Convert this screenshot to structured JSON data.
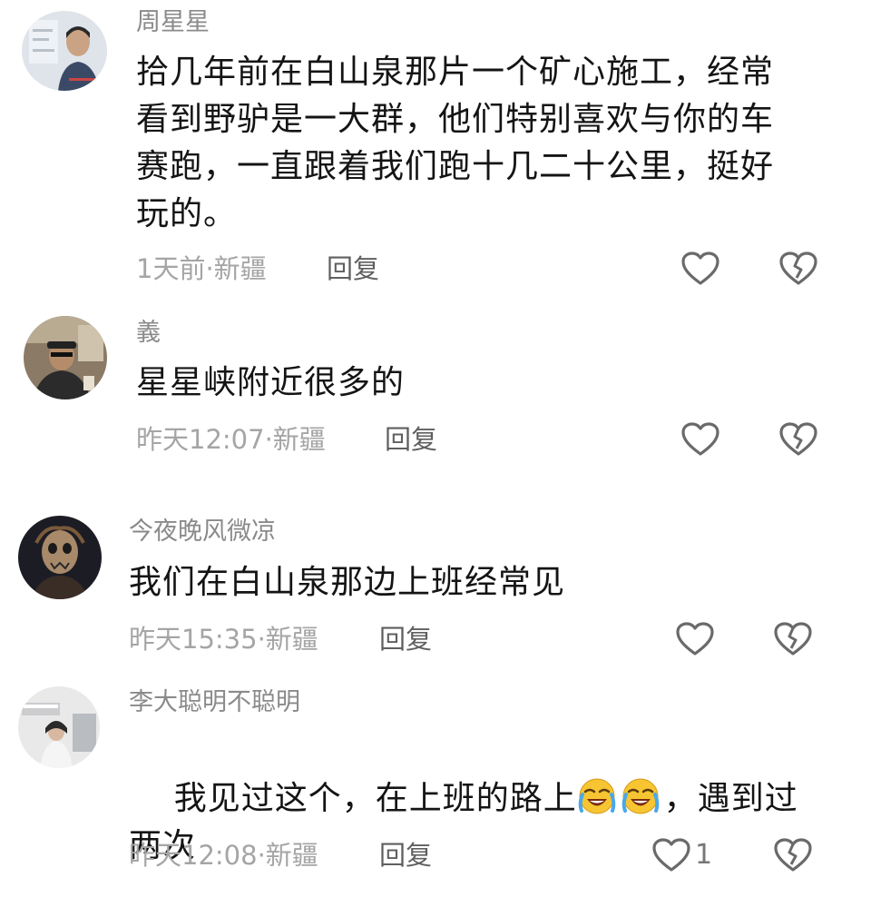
{
  "comments": [
    {
      "username": "周星星",
      "text": "拾几年前在白山泉那片一个矿心施工，经常\n看到野驴是一大群，他们特别喜欢与你的车\n赛跑，一直跟着我们跑十几二十公里，挺好\n玩的。",
      "meta": "1天前·新疆",
      "reply": "回复"
    },
    {
      "username": "義",
      "text": "星星峡附近很多的",
      "meta": "昨天12:07·新疆",
      "reply": "回复"
    },
    {
      "username": "今夜晚风微凉",
      "text": "我们在白山泉那边上班经常见",
      "meta": "昨天15:35·新疆",
      "reply": "回复"
    },
    {
      "username": "李大聪明不聪明",
      "text_before": "我见过这个，在上班的路上",
      "emoji": "loudly-crying-face-icon",
      "text_after": "，遇到过\n两次",
      "meta": "昨天12:08·新疆",
      "reply": "回复",
      "likes": "1"
    }
  ],
  "colors": {
    "username": "#8a8a8a",
    "text": "#141414",
    "meta": "#a5a5a5",
    "reply": "#5f5f5f",
    "icon": "#6a6a6a"
  },
  "icons": {
    "like": "heart-outline-icon",
    "dislike": "broken-heart-outline-icon"
  }
}
